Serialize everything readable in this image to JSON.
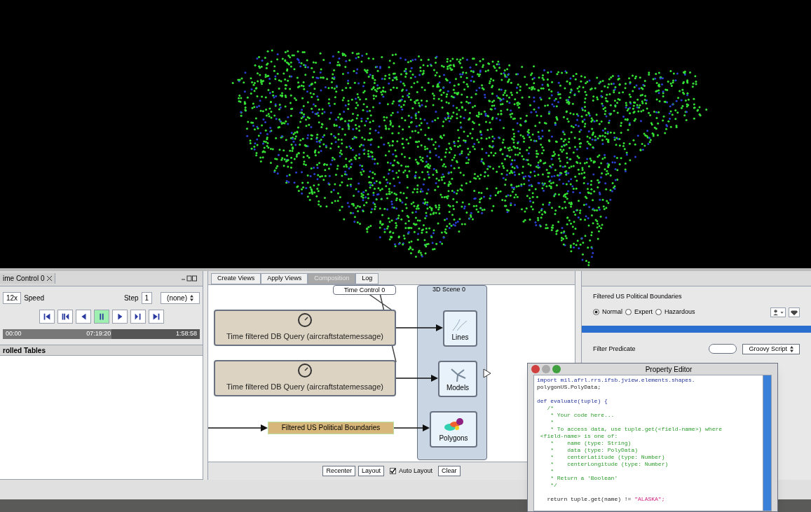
{
  "time_panel": {
    "tab": "ime Control 0",
    "speed_value": "12x",
    "speed_label": "Speed",
    "step_label": "Step",
    "step_value": "1",
    "unit": "(none)",
    "transport": [
      {
        "kind": "first",
        "selected": false
      },
      {
        "kind": "step_back",
        "selected": false
      },
      {
        "kind": "reverse",
        "selected": false
      },
      {
        "kind": "pause",
        "selected": true
      },
      {
        "kind": "play",
        "selected": false
      },
      {
        "kind": "step_forward",
        "selected": false
      },
      {
        "kind": "last",
        "selected": false
      }
    ],
    "timeline": {
      "level": 0.55,
      "start": "00:00",
      "current": "07:19:20",
      "end": "1:58:58"
    }
  },
  "tables_panel": {
    "title": "rolled Tables"
  },
  "graph": {
    "tabs": [
      {
        "label": "Create Views",
        "selected": false
      },
      {
        "label": "Apply Views",
        "selected": false
      },
      {
        "label": "Composition",
        "selected": true
      },
      {
        "label": "Log",
        "selected": false
      }
    ],
    "time_control": "Time Control 0",
    "scene": "3D Scene 0",
    "queries": [
      {
        "label": "Time filtered DB Query (aircraftstatemessage)"
      },
      {
        "label": "Time filtered DB Query (aircraftstatemessage)"
      }
    ],
    "filter": "Filtered US Political Boundaries",
    "layers": [
      {
        "kind": "lines",
        "label": "Lines"
      },
      {
        "kind": "models",
        "label": "Models"
      },
      {
        "kind": "polygons",
        "label": "Polygons"
      }
    ],
    "buttons": [
      "Recenter",
      "Layout"
    ],
    "auto_layout": {
      "label": "Auto Layout",
      "checked": true
    },
    "clear": "Clear"
  },
  "properties": {
    "title": "Filtered US Political Boundaries",
    "modes": [
      {
        "label": "Normal",
        "selected": true
      },
      {
        "label": "Expert",
        "selected": false
      },
      {
        "label": "Hazardous",
        "selected": false
      }
    ],
    "predicate_label": "Filter Predicate",
    "script_type": "Groovy Script"
  },
  "editor": {
    "title": "Property Editor",
    "lines": [
      {
        "kind": "keyword",
        "text": "import mil.afrl.rrs.ifsb.jview.elements.shapes."
      },
      {
        "kind": "plain",
        "text": "polygonUS.PolyData;"
      },
      {
        "kind": "blank"
      },
      {
        "kind": "keyword",
        "text": "def evaluate(tuple) {"
      },
      {
        "kind": "comment",
        "text": "   /*"
      },
      {
        "kind": "comment",
        "text": "    * Your code here..."
      },
      {
        "kind": "comment",
        "text": "    *"
      },
      {
        "kind": "comment",
        "text": "    * To access data, use tuple.get(<field-name>) where"
      },
      {
        "kind": "comment",
        "text": " <field-name> is one of:"
      },
      {
        "kind": "comment",
        "text": "    *    name (type: String)"
      },
      {
        "kind": "comment",
        "text": "    *    data (type: PolyData)"
      },
      {
        "kind": "comment",
        "text": "    *    centerLatitude (type: Number)"
      },
      {
        "kind": "comment",
        "text": "    *    centerLongitude (type: Number)"
      },
      {
        "kind": "comment",
        "text": "    *"
      },
      {
        "kind": "comment",
        "text": "    * Return a 'Boolean'"
      },
      {
        "kind": "comment",
        "text": "    */"
      },
      {
        "kind": "blank"
      },
      {
        "kind": "return",
        "text": "   return tuple.get(name) != ",
        "string": "\"ALASKA\";"
      }
    ]
  }
}
